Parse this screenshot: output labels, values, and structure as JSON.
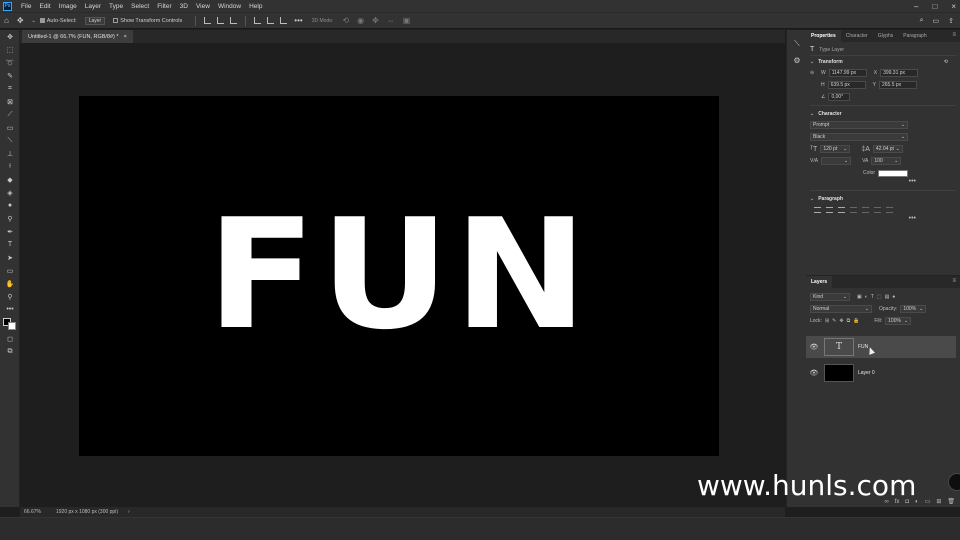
{
  "menu": {
    "logo": "Ps",
    "items": [
      "File",
      "Edit",
      "Image",
      "Layer",
      "Type",
      "Select",
      "Filter",
      "3D",
      "View",
      "Window",
      "Help"
    ]
  },
  "options": {
    "auto_select_label": "Auto-Select:",
    "auto_select_target": "Layer",
    "show_transform_label": "Show Transform Controls",
    "mode_3d_label": "3D Mode:"
  },
  "tab": {
    "title": "Untitled-1 @ 66.7% (FUN, RGB/8#) *",
    "close": "×"
  },
  "canvas": {
    "text": "FUN",
    "background": "#000000",
    "text_color": "#ffffff"
  },
  "status": {
    "zoom": "66.67%",
    "doc_info": "1920 px x 1080 px (300 ppi)",
    "arrow": "›"
  },
  "properties": {
    "tabs": [
      "Properties",
      "Character",
      "Glyphs",
      "Paragraph"
    ],
    "layer_kind": "Type Layer",
    "transform": {
      "title": "Transform",
      "w_label": "W",
      "w": "1147.99 px",
      "x_label": "X",
      "x": "399.31 px",
      "h_label": "H",
      "h": "639.5 px",
      "y_label": "Y",
      "y": "265.5 px",
      "angle": "0,00°"
    },
    "character": {
      "title": "Character",
      "font_family": "Prompt",
      "font_style": "Black",
      "size": "120 pt",
      "leading": "42.04 pt",
      "kerning": "",
      "tracking": "100",
      "color_label": "Color"
    },
    "paragraph": {
      "title": "Paragraph"
    }
  },
  "layers": {
    "tab": "Layers",
    "filter_kind": "Kind",
    "blend_mode": "Normal",
    "opacity_label": "Opacity:",
    "opacity": "100%",
    "lock_label": "Lock:",
    "fill_label": "Fill:",
    "fill": "100%",
    "items": [
      {
        "name": "FUN",
        "type": "text",
        "selected": true
      },
      {
        "name": "Layer 0",
        "type": "fill",
        "selected": false
      }
    ]
  },
  "watermark": "www.hunls.com",
  "colors": {
    "accent": "#31a8ff",
    "panel": "#323232"
  }
}
